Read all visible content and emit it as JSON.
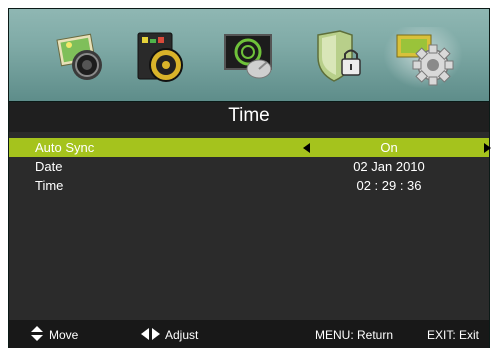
{
  "menu_icons": [
    {
      "name": "picture-icon",
      "selected": false
    },
    {
      "name": "sound-icon",
      "selected": false
    },
    {
      "name": "channel-icon",
      "selected": false
    },
    {
      "name": "lock-icon",
      "selected": false
    },
    {
      "name": "setup-icon",
      "selected": true
    }
  ],
  "title": "Time",
  "rows": [
    {
      "label": "Auto Sync",
      "value": "On",
      "selected": true
    },
    {
      "label": "Date",
      "value": "02  Jan  2010",
      "selected": false
    },
    {
      "label": "Time",
      "value": "02 : 29 : 36",
      "selected": false
    }
  ],
  "footer": {
    "move": "Move",
    "adjust": "Adjust",
    "menu": "MENU: Return",
    "exit": "EXIT: Exit"
  },
  "colors": {
    "highlight": "#a5c31d",
    "content_bg": "#2b2b2b",
    "iconbar_bg": "#7faaa6"
  }
}
